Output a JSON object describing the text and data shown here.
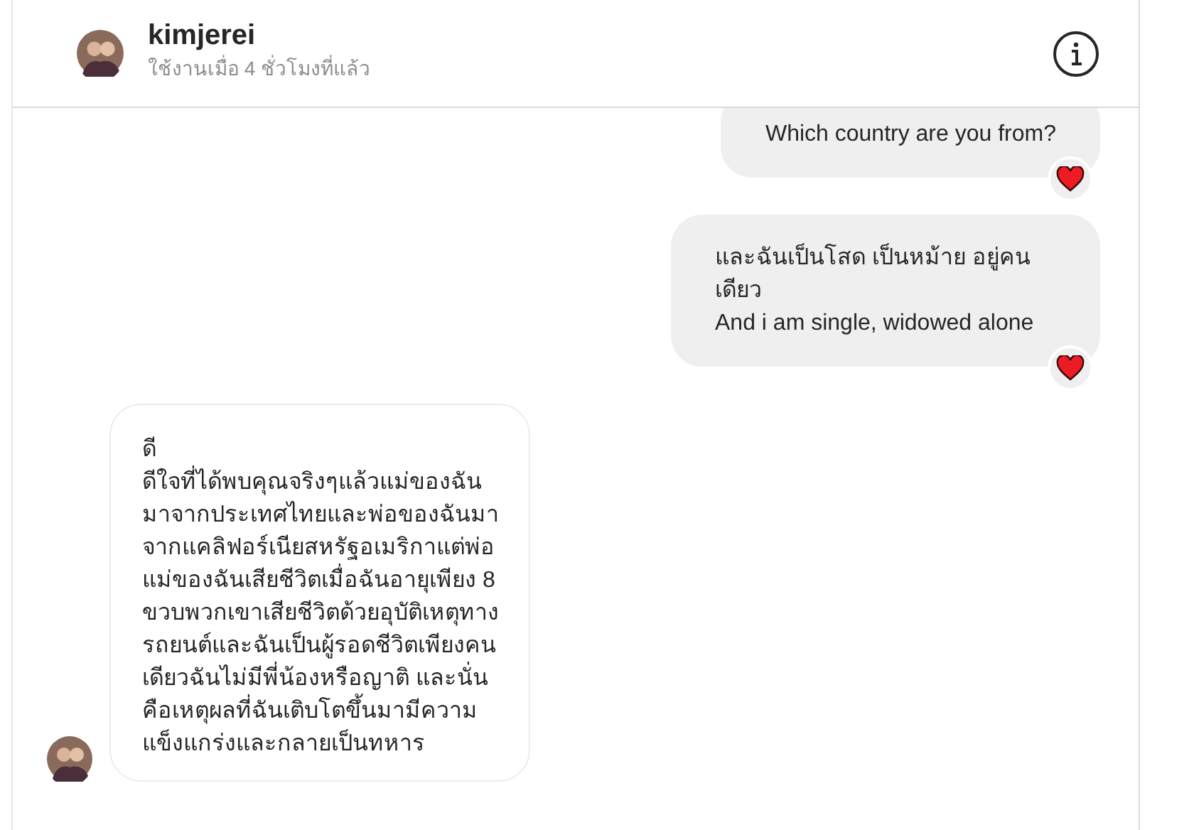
{
  "header": {
    "name": "kimjerei",
    "status": "ใช้งานเมื่อ 4 ชั่วโมงที่แล้ว"
  },
  "messages": [
    {
      "kind": "sent",
      "text": "Which country are you from?",
      "reacted": true
    },
    {
      "kind": "sent",
      "text": "และฉันเป็นโสด เป็นหม้าย อยู่คนเดียว\nAnd i am single, widowed alone",
      "reacted": true
    },
    {
      "kind": "received",
      "text": "ดี\nดีใจที่ได้พบคุณจริงๆแล้วแม่ของฉันมาจากประเทศไทยและพ่อของฉันมาจากแคลิฟอร์เนียสหรัฐอเมริกาแต่พ่อแม่ของฉันเสียชีวิตเมื่อฉันอายุเพียง 8 ขวบพวกเขาเสียชีวิตด้วยอุบัติเหตุทางรถยนต์และฉันเป็นผู้รอดชีวิตเพียงคนเดียวฉันไม่มีพี่น้องหรือญาติ และนั่นคือเหตุผลที่ฉันเติบโตขึ้นมามีความแข็งแกร่งและกลายเป็นทหาร",
      "reacted": false
    }
  ]
}
